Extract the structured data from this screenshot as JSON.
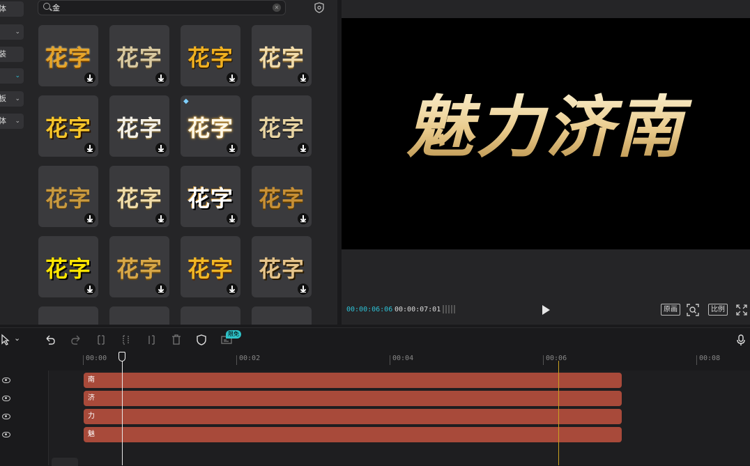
{
  "sidebar": {
    "items": [
      {
        "label": "体",
        "dropdown": false
      },
      {
        "label": "",
        "dropdown": true
      },
      {
        "label": "装",
        "dropdown": false
      },
      {
        "label": "",
        "dropdown": true,
        "active": true
      },
      {
        "label": "板",
        "dropdown": true
      },
      {
        "label": "体",
        "dropdown": true
      }
    ]
  },
  "search": {
    "value": "金",
    "placeholder": ""
  },
  "tiles": [
    {
      "text": "花字",
      "style": "gold1"
    },
    {
      "text": "花字",
      "style": "gold2"
    },
    {
      "text": "花字",
      "style": "gold3"
    },
    {
      "text": "花字",
      "style": "gold4"
    },
    {
      "text": "花字",
      "style": "gold5"
    },
    {
      "text": "花字",
      "style": "white1"
    },
    {
      "text": "花字",
      "style": "white2",
      "premium": true
    },
    {
      "text": "花字",
      "style": "gold6"
    },
    {
      "text": "花字",
      "style": "gold7"
    },
    {
      "text": "花字",
      "style": "gold8"
    },
    {
      "text": "花字",
      "style": "white3"
    },
    {
      "text": "花字",
      "style": "gold9"
    },
    {
      "text": "花字",
      "style": "yellow1"
    },
    {
      "text": "花字",
      "style": "gold10"
    },
    {
      "text": "花字",
      "style": "gold11"
    },
    {
      "text": "花字",
      "style": "gold12"
    }
  ],
  "preview": {
    "title_text": "魅力济南",
    "current_time": "00:00:06:06",
    "total_time": "00:00:07:01",
    "original_label": "原画",
    "ratio_label": "比例"
  },
  "toolbar": {
    "free_badge": "限免"
  },
  "ruler": {
    "labels": [
      "00:00",
      "00:02",
      "00:04",
      "00:06",
      "00:08"
    ]
  },
  "tracks": [
    {
      "label": "南"
    },
    {
      "label": "济"
    },
    {
      "label": "力"
    },
    {
      "label": "魅"
    }
  ],
  "colors": {
    "accent": "#2ec2d6",
    "clip": "#a84a3a",
    "gold": "#e6c070"
  }
}
